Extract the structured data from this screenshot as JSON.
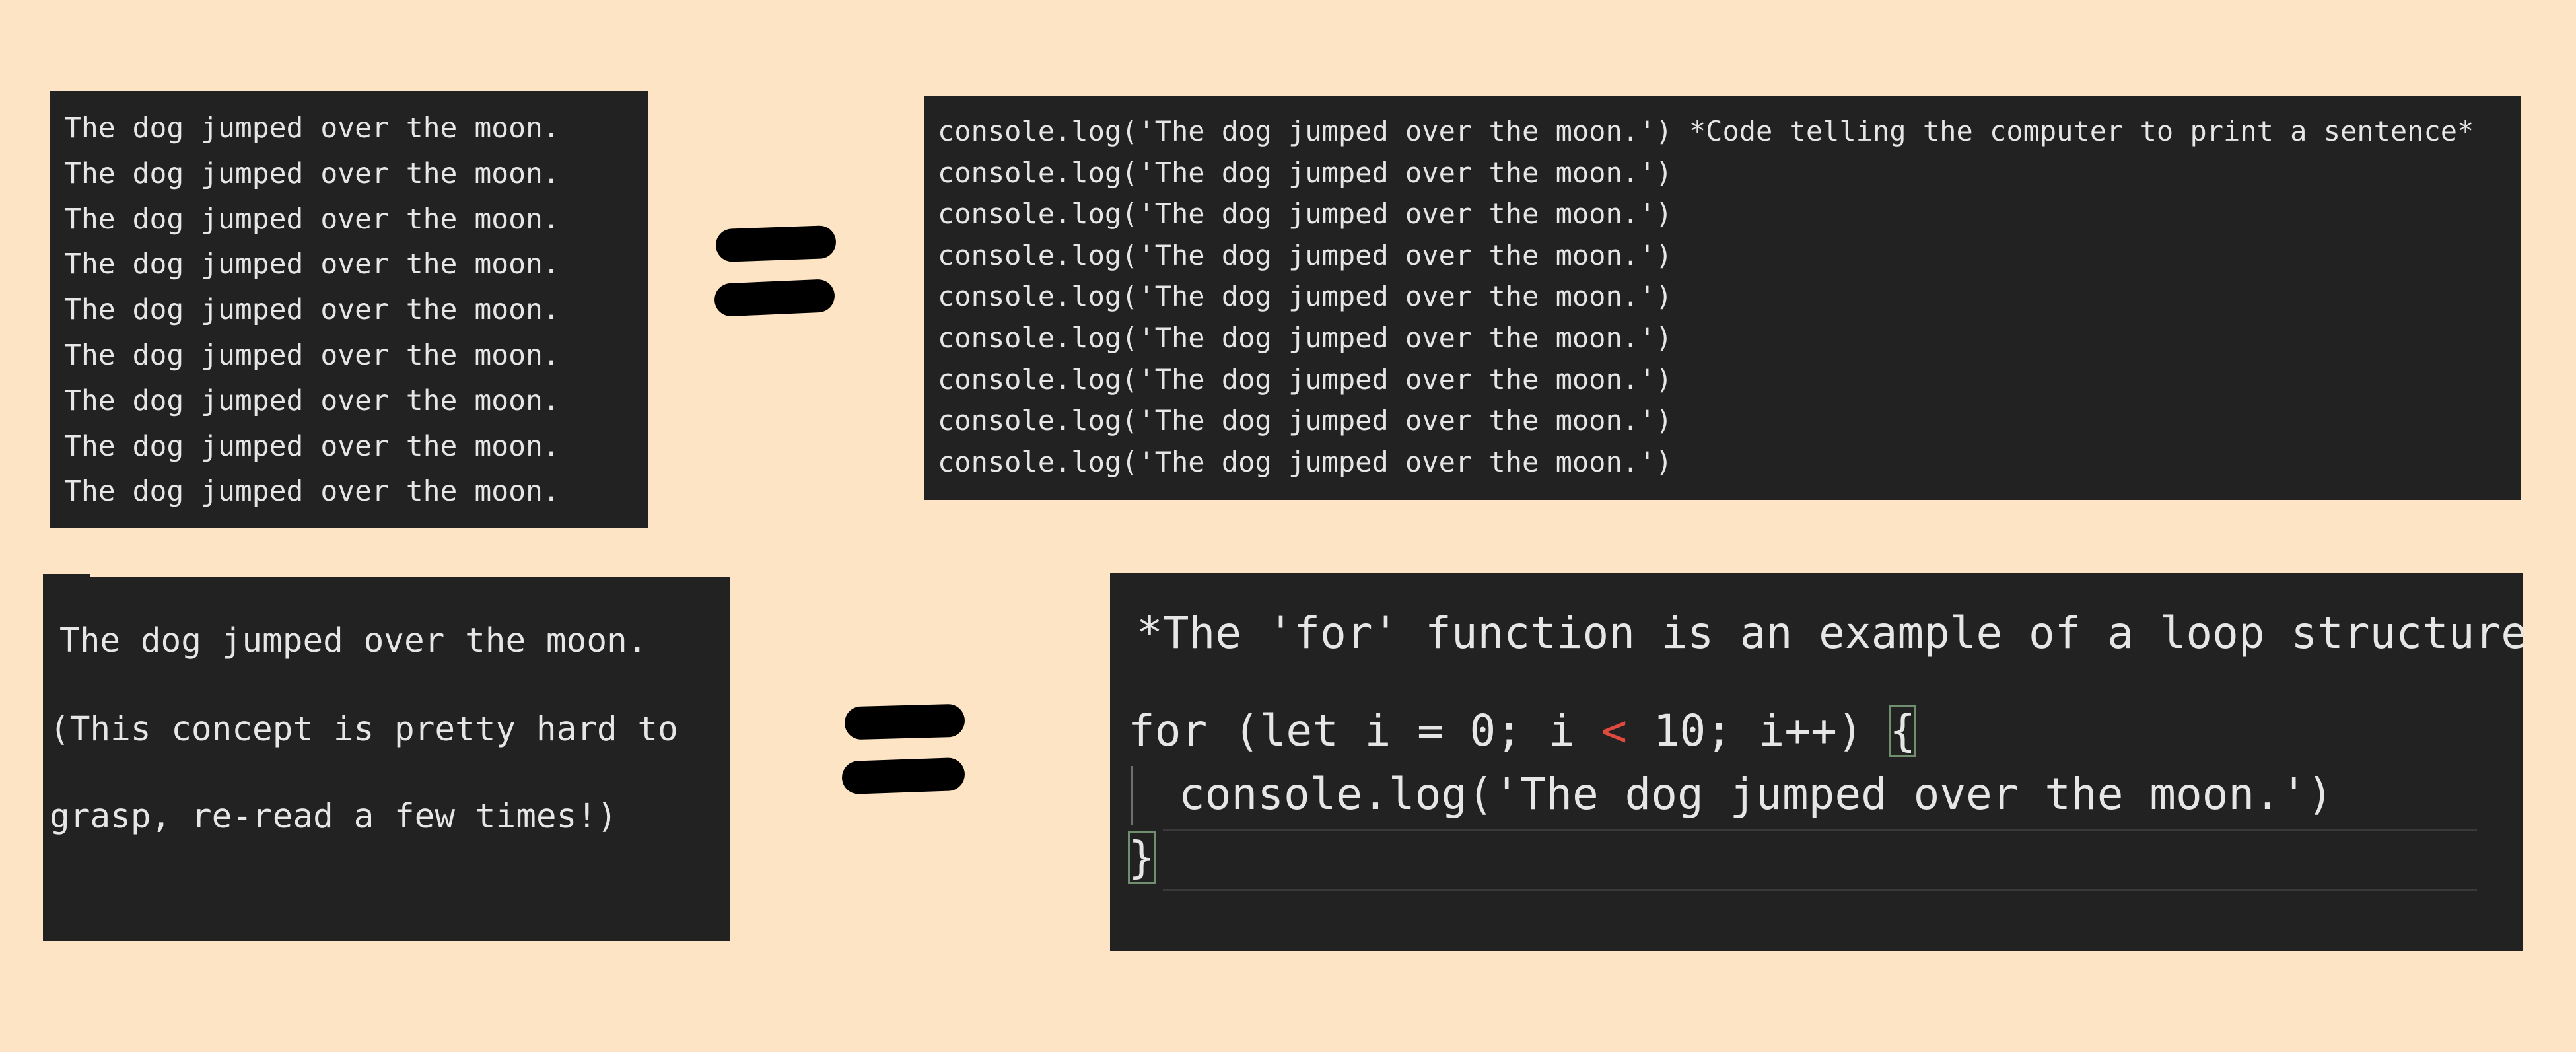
{
  "output_panel": {
    "lines": [
      "The dog jumped over the moon.",
      "The dog jumped over the moon.",
      "The dog jumped over the moon.",
      "The dog jumped over the moon.",
      "The dog jumped over the moon.",
      "The dog jumped over the moon.",
      "The dog jumped over the moon.",
      "The dog jumped over the moon.",
      "The dog jumped over the moon."
    ]
  },
  "code_panel": {
    "lines": [
      "console.log('The dog jumped over the moon.') *Code telling the computer to print a sentence*",
      "console.log('The dog jumped over the moon.')",
      "console.log('The dog jumped over the moon.')",
      "console.log('The dog jumped over the moon.')",
      "console.log('The dog jumped over the moon.')",
      "console.log('The dog jumped over the moon.')",
      "console.log('The dog jumped over the moon.')",
      "console.log('The dog jumped over the moon.')",
      "console.log('The dog jumped over the moon.')"
    ]
  },
  "explain_panel": {
    "lines": [
      "The dog jumped over the moon.",
      "(This concept is pretty hard to",
      "grasp, re-read a few times!)"
    ]
  },
  "loop_panel": {
    "comment": "*The 'for' function is an example of a loop structure",
    "for_start": "for (let i = 0; i ",
    "less_than": "<",
    "for_end": " 10; i++) ",
    "open_brace": "{",
    "body": "console.log('The dog jumped over the moon.')",
    "close_brace": "}"
  },
  "colors": {
    "background": "#fde4c4",
    "panel": "#222222",
    "text": "#e6e6e6",
    "operator": "#e0493d"
  }
}
